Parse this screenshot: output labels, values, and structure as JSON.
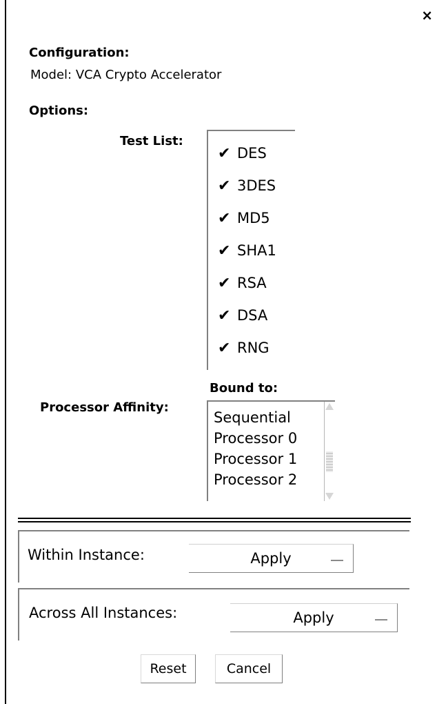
{
  "window": {
    "close_label": "×"
  },
  "configuration": {
    "heading": "Configuration:",
    "model_text": "Model: VCA Crypto Accelerator"
  },
  "options": {
    "heading": "Options:"
  },
  "test_list": {
    "label": "Test List:",
    "items": [
      {
        "label": "DES",
        "checked": true
      },
      {
        "label": "3DES",
        "checked": true
      },
      {
        "label": "MD5",
        "checked": true
      },
      {
        "label": "SHA1",
        "checked": true
      },
      {
        "label": "RSA",
        "checked": true
      },
      {
        "label": "DSA",
        "checked": true
      },
      {
        "label": "RNG",
        "checked": true
      }
    ],
    "check_glyph": "✔"
  },
  "affinity": {
    "label": "Processor Affinity:",
    "bound_label": "Bound to:",
    "options": [
      "Sequential",
      "Processor 0",
      "Processor 1",
      "Processor 2"
    ]
  },
  "within_instance": {
    "label": "Within Instance:",
    "button_label": "Apply"
  },
  "across_instances": {
    "label": "Across All Instances:",
    "button_label": "Apply"
  },
  "footer": {
    "reset_label": "Reset",
    "cancel_label": "Cancel"
  }
}
